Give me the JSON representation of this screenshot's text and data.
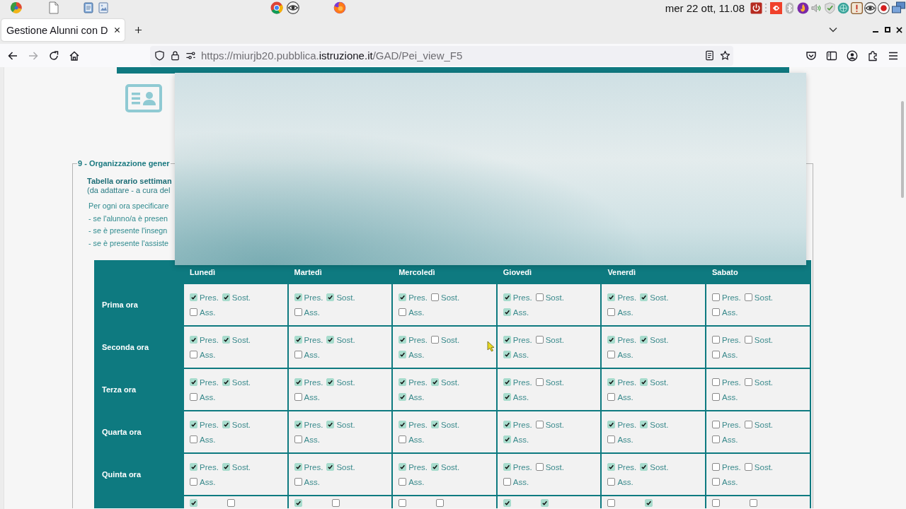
{
  "system_bar": {
    "clock": "mer 22 ott, 11.08"
  },
  "browser": {
    "tabs": [
      {
        "title": "Gestione Alunni con D",
        "selected": true
      }
    ],
    "can_go_forward": false,
    "address": {
      "prefix": "https://miurjb20.pubblica.",
      "domain": "istruzione.it",
      "path": "/GAD/Pei_view_F5"
    }
  },
  "section": {
    "legend": "9 - Organizzazione gener",
    "heading": "Tabella orario settiman",
    "note": "(da adattare - a cura del",
    "instructions": [
      "Per ogni ora specificare",
      "- se l'alunno/a è presen",
      "- se è presente l'insegn",
      "- se è presente l'assiste"
    ]
  },
  "schedule": {
    "days": [
      "Lunedì",
      "Martedì",
      "Mercoledì",
      "Giovedì",
      "Venerdì",
      "Sabato"
    ],
    "rows": [
      {
        "label": "Prima ora",
        "cells": [
          {
            "options": [
              {
                "label": "Pres.",
                "checked": true
              },
              {
                "label": "Sost.",
                "checked": true
              },
              {
                "label": "Ass.",
                "checked": false
              }
            ]
          },
          {
            "options": [
              {
                "label": "Pres.",
                "checked": true
              },
              {
                "label": "Sost.",
                "checked": true
              },
              {
                "label": "Ass.",
                "checked": false
              }
            ]
          },
          {
            "options": [
              {
                "label": "Pres.",
                "checked": true
              },
              {
                "label": "Sost.",
                "checked": false
              },
              {
                "label": "Ass.",
                "checked": false
              }
            ]
          },
          {
            "options": [
              {
                "label": "Pres.",
                "checked": true
              },
              {
                "label": "Sost.",
                "checked": false
              },
              {
                "label": "Ass.",
                "checked": true
              }
            ]
          },
          {
            "options": [
              {
                "label": "Pres.",
                "checked": true
              },
              {
                "label": "Sost.",
                "checked": true
              },
              {
                "label": "Ass.",
                "checked": false
              }
            ]
          },
          {
            "options": [
              {
                "label": "Pres.",
                "checked": false
              },
              {
                "label": "Sost.",
                "checked": false
              },
              {
                "label": "Ass.",
                "checked": false
              }
            ]
          }
        ]
      },
      {
        "label": "Seconda ora",
        "cells": [
          {
            "options": [
              {
                "label": "Pres.",
                "checked": true
              },
              {
                "label": "Sost.",
                "checked": true
              },
              {
                "label": "Ass.",
                "checked": false
              }
            ]
          },
          {
            "options": [
              {
                "label": "Pres.",
                "checked": true
              },
              {
                "label": "Sost.",
                "checked": true
              },
              {
                "label": "Ass.",
                "checked": false
              }
            ]
          },
          {
            "options": [
              {
                "label": "Pres.",
                "checked": true
              },
              {
                "label": "Sost.",
                "checked": false
              },
              {
                "label": "Ass.",
                "checked": true
              }
            ]
          },
          {
            "options": [
              {
                "label": "Pres.",
                "checked": true
              },
              {
                "label": "Sost.",
                "checked": false
              },
              {
                "label": "Ass.",
                "checked": true
              }
            ]
          },
          {
            "options": [
              {
                "label": "Pres.",
                "checked": true
              },
              {
                "label": "Sost.",
                "checked": true
              },
              {
                "label": "Ass.",
                "checked": false
              }
            ]
          },
          {
            "options": [
              {
                "label": "Pres.",
                "checked": false
              },
              {
                "label": "Sost.",
                "checked": false
              },
              {
                "label": "Ass.",
                "checked": false
              }
            ]
          }
        ]
      },
      {
        "label": "Terza ora",
        "cells": [
          {
            "options": [
              {
                "label": "Pres.",
                "checked": true
              },
              {
                "label": "Sost.",
                "checked": true
              },
              {
                "label": "Ass.",
                "checked": false
              }
            ]
          },
          {
            "options": [
              {
                "label": "Pres.",
                "checked": true
              },
              {
                "label": "Sost.",
                "checked": true
              },
              {
                "label": "Ass.",
                "checked": false
              }
            ]
          },
          {
            "options": [
              {
                "label": "Pres.",
                "checked": true
              },
              {
                "label": "Sost.",
                "checked": true
              },
              {
                "label": "Ass.",
                "checked": true
              }
            ]
          },
          {
            "options": [
              {
                "label": "Pres.",
                "checked": true
              },
              {
                "label": "Sost.",
                "checked": false
              },
              {
                "label": "Ass.",
                "checked": true
              }
            ]
          },
          {
            "options": [
              {
                "label": "Pres.",
                "checked": true
              },
              {
                "label": "Sost.",
                "checked": true
              },
              {
                "label": "Ass.",
                "checked": false
              }
            ]
          },
          {
            "options": [
              {
                "label": "Pres.",
                "checked": false
              },
              {
                "label": "Sost.",
                "checked": false
              },
              {
                "label": "Ass.",
                "checked": false
              }
            ]
          }
        ]
      },
      {
        "label": "Quarta ora",
        "cells": [
          {
            "options": [
              {
                "label": "Pres.",
                "checked": true
              },
              {
                "label": "Sost.",
                "checked": true
              },
              {
                "label": "Ass.",
                "checked": false
              }
            ]
          },
          {
            "options": [
              {
                "label": "Pres.",
                "checked": true
              },
              {
                "label": "Sost.",
                "checked": true
              },
              {
                "label": "Ass.",
                "checked": false
              }
            ]
          },
          {
            "options": [
              {
                "label": "Pres.",
                "checked": true
              },
              {
                "label": "Sost.",
                "checked": true
              },
              {
                "label": "Ass.",
                "checked": false
              }
            ]
          },
          {
            "options": [
              {
                "label": "Pres.",
                "checked": true
              },
              {
                "label": "Sost.",
                "checked": false
              },
              {
                "label": "Ass.",
                "checked": true
              }
            ]
          },
          {
            "options": [
              {
                "label": "Pres.",
                "checked": true
              },
              {
                "label": "Sost.",
                "checked": true
              },
              {
                "label": "Ass.",
                "checked": false
              }
            ]
          },
          {
            "options": [
              {
                "label": "Pres.",
                "checked": false
              },
              {
                "label": "Sost.",
                "checked": false
              },
              {
                "label": "Ass.",
                "checked": false
              }
            ]
          }
        ]
      },
      {
        "label": "Quinta ora",
        "cells": [
          {
            "options": [
              {
                "label": "Pres.",
                "checked": true
              },
              {
                "label": "Sost.",
                "checked": true
              },
              {
                "label": "Ass.",
                "checked": false
              }
            ]
          },
          {
            "options": [
              {
                "label": "Pres.",
                "checked": true
              },
              {
                "label": "Sost.",
                "checked": true
              },
              {
                "label": "Ass.",
                "checked": false
              }
            ]
          },
          {
            "options": [
              {
                "label": "Pres.",
                "checked": true
              },
              {
                "label": "Sost.",
                "checked": true
              },
              {
                "label": "Ass.",
                "checked": false
              }
            ]
          },
          {
            "options": [
              {
                "label": "Pres.",
                "checked": true
              },
              {
                "label": "Sost.",
                "checked": false
              },
              {
                "label": "Ass.",
                "checked": false
              }
            ]
          },
          {
            "options": [
              {
                "label": "Pres.",
                "checked": true
              },
              {
                "label": "Sost.",
                "checked": true
              },
              {
                "label": "Ass.",
                "checked": false
              }
            ]
          },
          {
            "options": [
              {
                "label": "Pres.",
                "checked": false
              },
              {
                "label": "Sost.",
                "checked": false
              },
              {
                "label": "Ass.",
                "checked": false
              }
            ]
          }
        ]
      }
    ],
    "partial_row": {
      "cells": [
        {
          "options": [
            {
              "checked": true
            },
            {
              "checked": false
            }
          ]
        },
        {
          "options": [
            {
              "checked": true
            },
            {
              "checked": false
            }
          ]
        },
        {
          "options": [
            {
              "checked": false
            },
            {
              "checked": false
            }
          ]
        },
        {
          "options": [
            {
              "checked": true
            },
            {
              "checked": true
            }
          ]
        },
        {
          "options": [
            {
              "checked": false
            },
            {
              "checked": true
            }
          ]
        },
        {
          "options": [
            {
              "checked": false
            },
            {
              "checked": false
            }
          ]
        }
      ]
    }
  }
}
